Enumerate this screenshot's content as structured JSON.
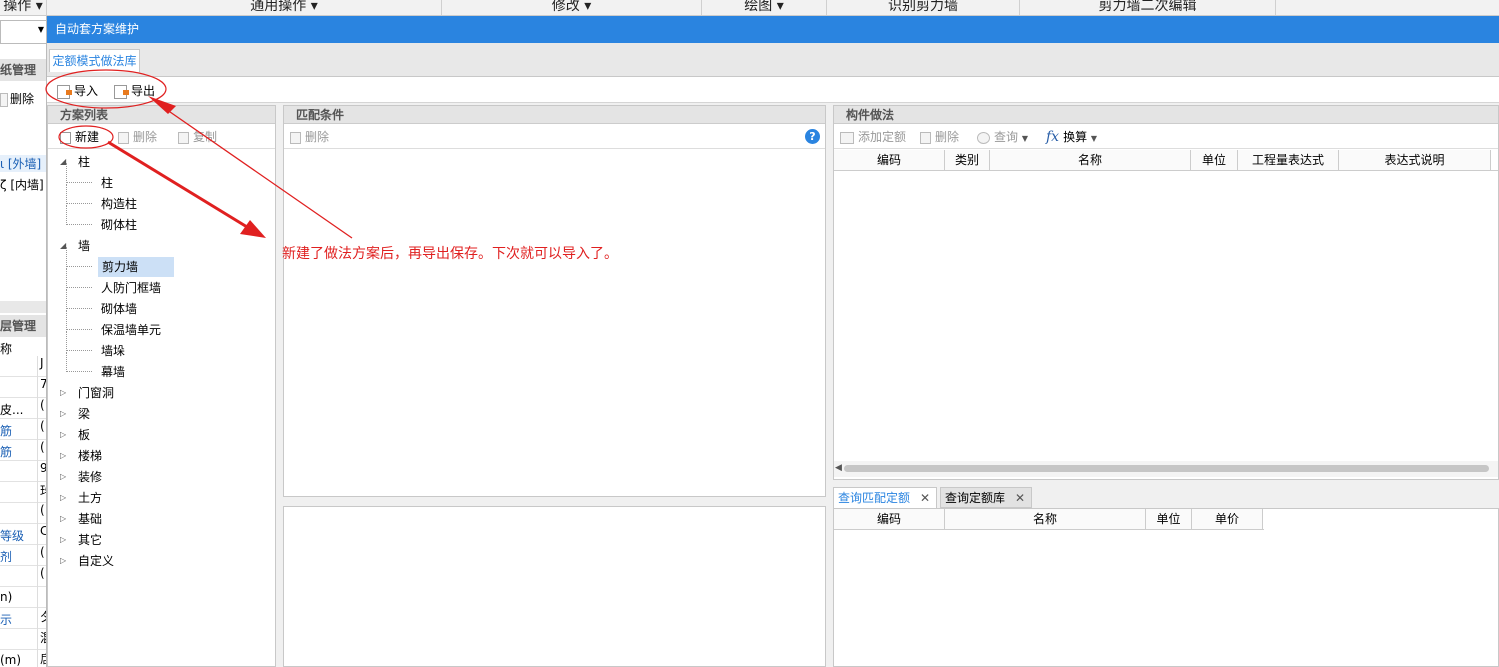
{
  "topmenu": {
    "items": [
      {
        "label": "操作"
      },
      {
        "label": "通用操作"
      },
      {
        "label": "修改"
      },
      {
        "label": "绘图"
      },
      {
        "label": "识别剪力墙"
      },
      {
        "label": "剪力墙二次编辑"
      }
    ]
  },
  "background_left": {
    "section1_title": "纸管理",
    "delete_label": "删除",
    "item_outer": "[外墙]",
    "item_inner": "[内墙]",
    "section2_title": "层管理",
    "col_name": "称",
    "rows": [
      {
        "label": "",
        "v": "J"
      },
      {
        "label": "",
        "v": "7"
      },
      {
        "label": "皮...",
        "v": "("
      },
      {
        "label": "筋",
        "v": "("
      },
      {
        "label": "筋",
        "v": "("
      },
      {
        "label": "",
        "v": "9"
      },
      {
        "label": "",
        "v": "玙"
      },
      {
        "label": "",
        "v": "("
      },
      {
        "label": "等级",
        "v": "C"
      },
      {
        "label": "剂",
        "v": "("
      },
      {
        "label": "",
        "v": "("
      },
      {
        "label": "n)",
        "v": ""
      },
      {
        "label": "示",
        "v": "夕"
      },
      {
        "label": "",
        "v": "混"
      },
      {
        "label": "(m)",
        "v": "扂"
      }
    ]
  },
  "dialog": {
    "title": "自动套方案维护",
    "tab": "定额模式做法库",
    "toolbar": {
      "import": "导入",
      "export": "导出"
    },
    "plan_list": {
      "title": "方案列表",
      "new": "新建",
      "delete": "删除",
      "copy": "复制",
      "tree": [
        {
          "label": "柱",
          "level": 0,
          "expanded": true
        },
        {
          "label": "柱",
          "level": 1
        },
        {
          "label": "构造柱",
          "level": 1
        },
        {
          "label": "砌体柱",
          "level": 1
        },
        {
          "label": "墙",
          "level": 0,
          "expanded": true
        },
        {
          "label": "剪力墙",
          "level": 1,
          "selected": true
        },
        {
          "label": "人防门框墙",
          "level": 1
        },
        {
          "label": "砌体墙",
          "level": 1
        },
        {
          "label": "保温墙单元",
          "level": 1
        },
        {
          "label": "墙垛",
          "level": 1
        },
        {
          "label": "幕墙",
          "level": 1
        },
        {
          "label": "门窗洞",
          "level": 0
        },
        {
          "label": "梁",
          "level": 0
        },
        {
          "label": "板",
          "level": 0
        },
        {
          "label": "楼梯",
          "level": 0
        },
        {
          "label": "装修",
          "level": 0
        },
        {
          "label": "土方",
          "level": 0
        },
        {
          "label": "基础",
          "level": 0
        },
        {
          "label": "其它",
          "level": 0
        },
        {
          "label": "自定义",
          "level": 0
        }
      ]
    },
    "match": {
      "title": "匹配条件",
      "delete": "删除"
    },
    "component": {
      "title": "构件做法",
      "add_quota": "添加定额",
      "delete": "删除",
      "query": "查询",
      "convert": "换算",
      "columns": [
        "编码",
        "类别",
        "名称",
        "单位",
        "工程量表达式",
        "表达式说明"
      ]
    },
    "bottom_tabs": [
      {
        "label": "查询匹配定额",
        "active": true
      },
      {
        "label": "查询定额库",
        "active": false
      }
    ],
    "bottom_columns": [
      "编码",
      "名称",
      "单位",
      "单价"
    ]
  },
  "annotation": {
    "text": "新建了做法方案后，再导出保存。下次就可以导入了。",
    "color": "#e02020"
  },
  "colors": {
    "title_bar": "#2a84e0",
    "annotation_red": "#e02020",
    "selection": "#cce0f6"
  }
}
